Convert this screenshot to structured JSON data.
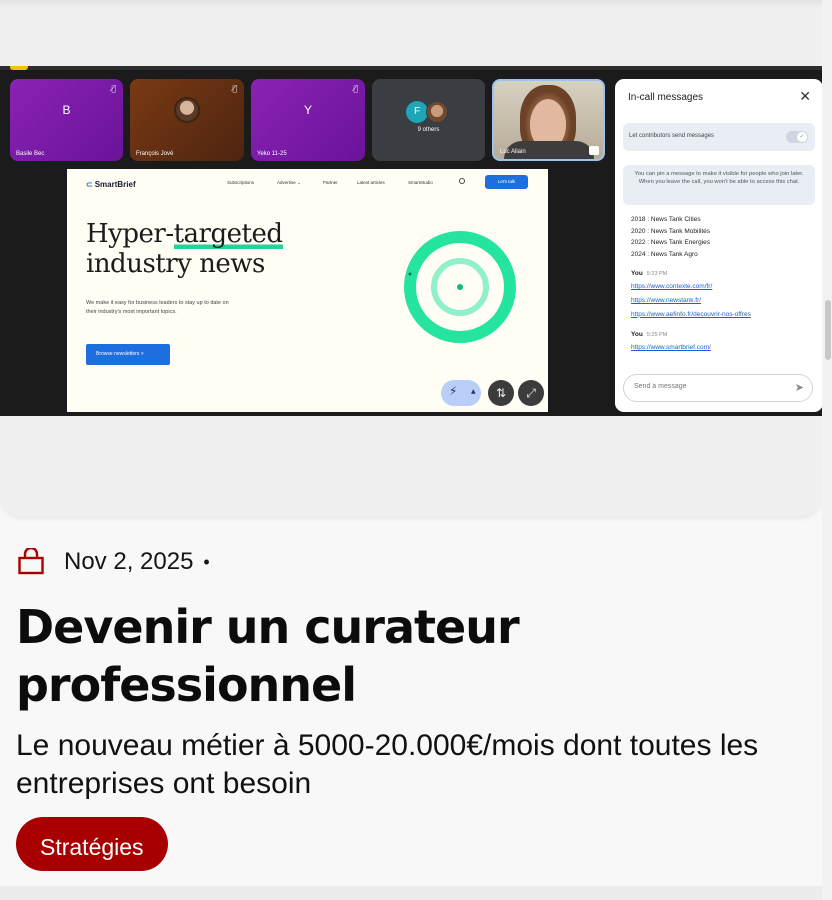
{
  "meeting": {
    "participants": [
      {
        "name": "Basile Bec",
        "initial": "B"
      },
      {
        "name": "François Jové",
        "initial": ""
      },
      {
        "name": "Yeko 11-25",
        "initial": "Y"
      },
      {
        "name": "",
        "initial": "F",
        "others_label": "9 others"
      },
      {
        "name": "Luc Allain",
        "initial": ""
      }
    ],
    "slide": {
      "logo": "SmartBrief",
      "nav": [
        "Subscriptions",
        "Advertise ⌄",
        "Partner",
        "Latest articles",
        "SmartStudio"
      ],
      "cta": "Let's talk",
      "hero_line1_a": "Hyper-",
      "hero_line1_b": "targeted",
      "hero_line2": "industry news",
      "subtext": "We make it easy for business leaders to stay up to date on their industry's most important topics.",
      "button": "Browse newsletters  >"
    },
    "chat": {
      "title": "In-call messages",
      "toggle_label": "Let contributors send messages",
      "info": "You can pin a message to make it visible for people who join later. When you leave the call, you won't be able to access this chat.",
      "lines": [
        "2018 : News Tank Cities",
        "2020 : News Tank Mobilités",
        "2022 : News Tank Energies",
        "2024 : News Tank Agro"
      ],
      "messages": [
        {
          "sender": "You",
          "time": "5:23 PM",
          "links": [
            "https://www.contexte.com/fr/",
            "https://www.newstank.fr/",
            "https://www.aefinfo.fr/decouvrir-nos-offres"
          ]
        },
        {
          "sender": "You",
          "time": "5:25 PM",
          "links": [
            "https://www.smartbrief.com/"
          ]
        }
      ],
      "input_placeholder": "Send a message"
    }
  },
  "article": {
    "date": "Nov 2, 2025",
    "separator": "•",
    "title": "Devenir un curateur professionnel",
    "subtitle": "Le nouveau métier à 5000-20.000€/mois dont toutes les entreprises ont besoin",
    "tag": "Stratégies",
    "icon": "shopping-bag-icon",
    "accent_color": "#a80000"
  }
}
